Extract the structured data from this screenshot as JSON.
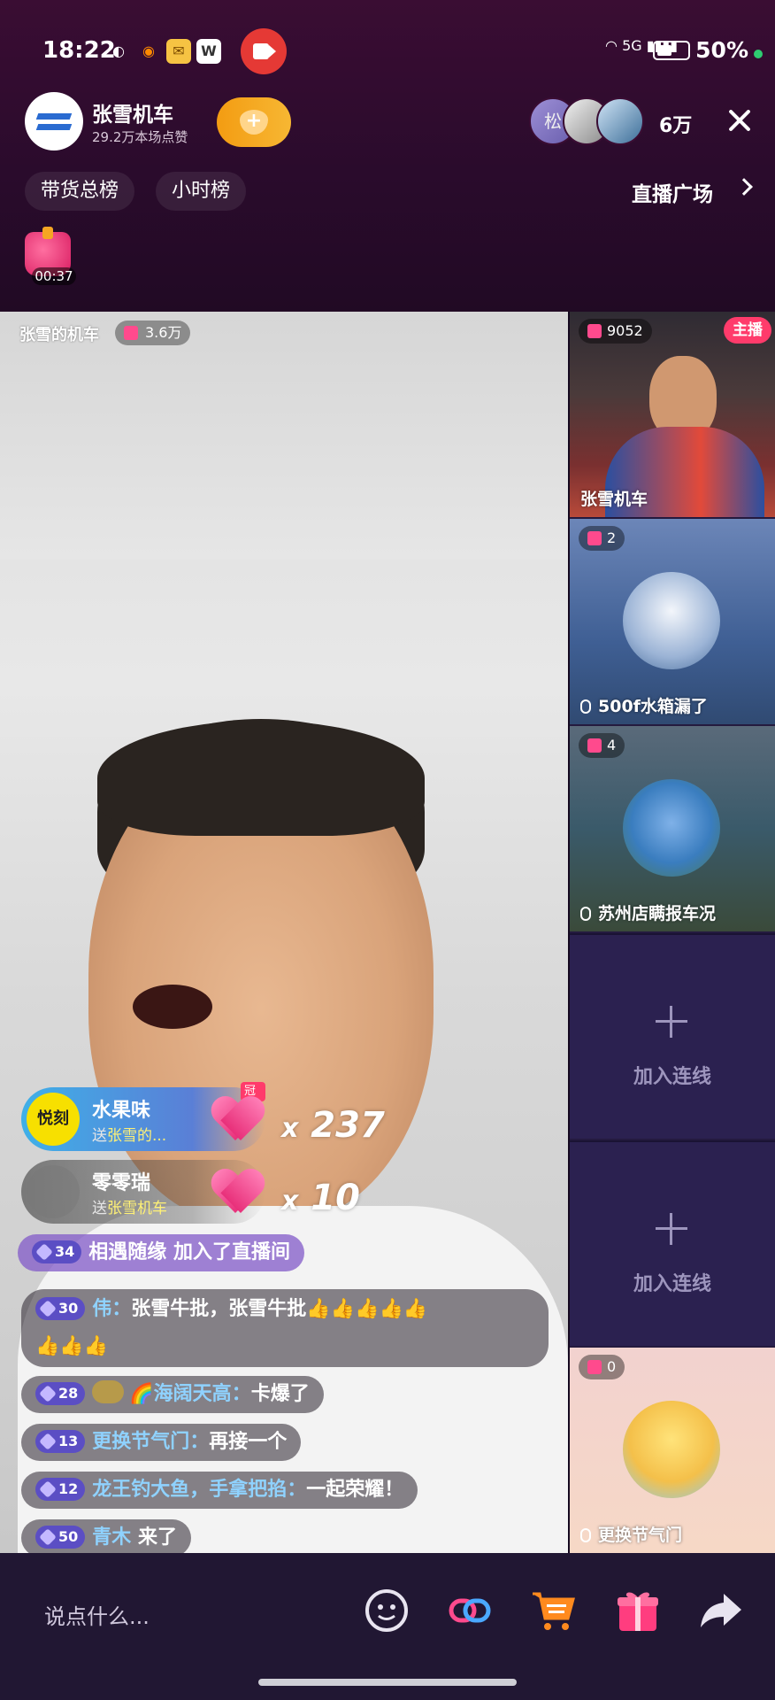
{
  "status": {
    "time": "18:22",
    "network": "5G",
    "battery": "50%"
  },
  "header": {
    "host_name": "张雪机车",
    "host_likes": "29.2万本场点赞",
    "viewer_count": "6万",
    "avatar_initial": "松",
    "tabs": [
      "带货总榜",
      "小时榜"
    ],
    "plaza_label": "直播广场",
    "gift_timer": "00:37"
  },
  "video": {
    "room_name": "张雪的机车",
    "room_count": "3.6万"
  },
  "side": {
    "host_badge": "主播",
    "tiles": [
      {
        "count": "9052",
        "name": "张雪机车"
      },
      {
        "count": "2",
        "name": "500f水箱漏了"
      },
      {
        "count": "4",
        "name": "苏州店瞒报车况"
      },
      {
        "add_label": "加入连线"
      },
      {
        "add_label": "加入连线"
      },
      {
        "count": "0",
        "name": "更换节气门"
      }
    ]
  },
  "gifts": [
    {
      "badge": "悦刻",
      "crown": "冠名",
      "user": "水果味",
      "prefix": "送",
      "target": "张雪的...",
      "mult_x": "x",
      "mult": "237"
    },
    {
      "user": "零零瑞",
      "prefix": "送",
      "target": "张雪机车",
      "mult_x": "x",
      "mult": "10"
    }
  ],
  "join": {
    "level": "34",
    "user": "相遇随缘",
    "text": "加入了直播间"
  },
  "chat": [
    {
      "level": "30",
      "user": "伟：",
      "text": "张雪牛批，张雪牛批",
      "emoji1": "👍👍👍👍👍",
      "emoji2": "👍👍👍"
    },
    {
      "level": "28",
      "rainbow": "🌈",
      "user": "海阔天高：",
      "text": "卡爆了"
    },
    {
      "level": "13",
      "user": "更换节气门：",
      "text": "再接一个"
    },
    {
      "level": "12",
      "user": "龙王钓大鱼，手拿把掐：",
      "text": "一起荣耀！"
    },
    {
      "level": "50",
      "user": "青木",
      "text": "来了"
    }
  ],
  "bottom": {
    "placeholder": "说点什么..."
  },
  "colors": {
    "accent_pink": "#ff3b6b",
    "bg_purple": "#241a3f",
    "username_blue": "#8fd2ff"
  }
}
